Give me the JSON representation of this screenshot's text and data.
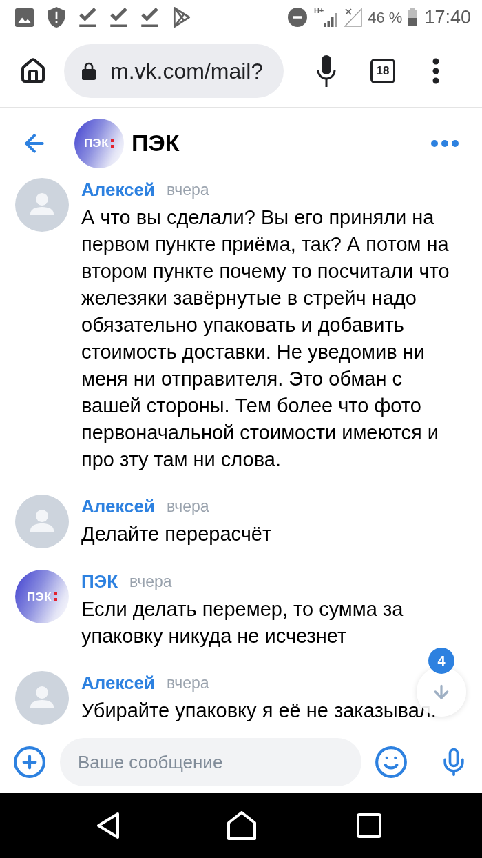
{
  "status_bar": {
    "network_type": "H+",
    "battery_text": "46 %",
    "time": "17:40"
  },
  "browser_bar": {
    "url": "m.vk.com/mail?",
    "tab_count": "18"
  },
  "chat_header": {
    "title": "ПЭК",
    "logo_text": "ПЭК"
  },
  "messages": [
    {
      "kind": "person",
      "author": "Алексей",
      "time": "вчера",
      "text": "А что вы сделали? Вы его приняли на первом пункте приёма, так? А потом на втором пункте почему то посчитали что железяки завёрнутые в стрейч надо обязательно упаковать и добавить стоимость доставки. Не уведомив ни меня ни отправителя. Это обман с вашей стороны. Тем более что фото первоначальной стоимости имеются и про зту там ни слова."
    },
    {
      "kind": "person",
      "author": "Алексей",
      "time": "вчера",
      "text": "Делайте перерасчёт"
    },
    {
      "kind": "logo",
      "logo_text": "ПЭК",
      "author": "ПЭК",
      "time": "вчера",
      "text": "Если делать перемер, то сумма за упаковку никуда не исчезнет"
    },
    {
      "kind": "person",
      "author": "Алексей",
      "time": "вчера",
      "text": "Убирайте упаковку я её не заказывал."
    }
  ],
  "scroll_down_button": {
    "badge": "4"
  },
  "composer": {
    "placeholder": "Ваше сообщение"
  }
}
